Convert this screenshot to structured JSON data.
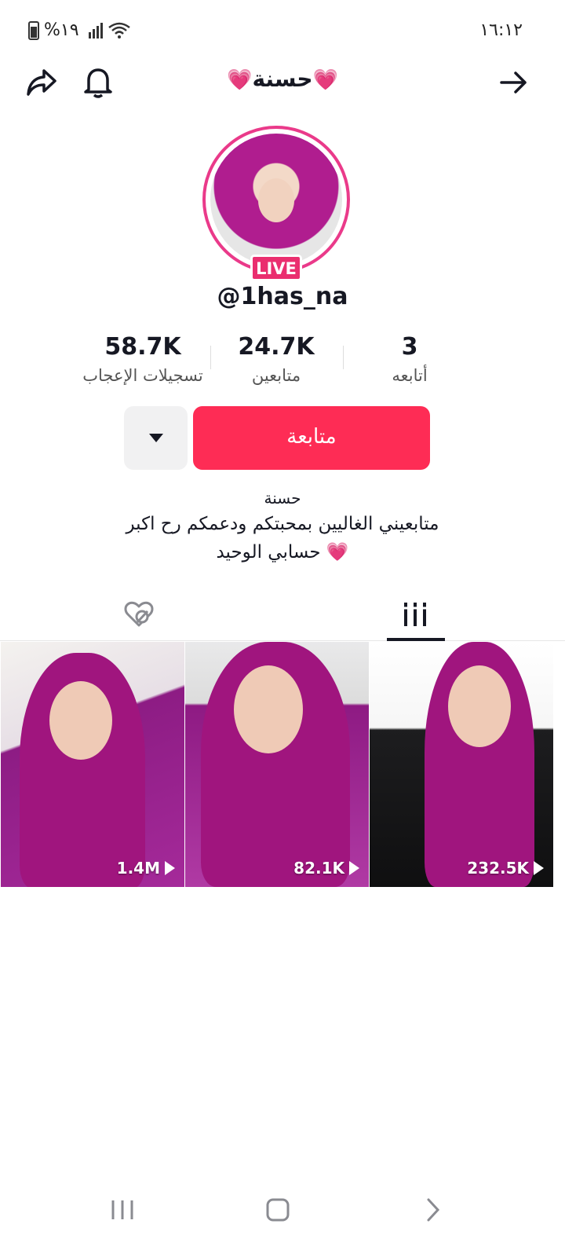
{
  "status_bar": {
    "battery_text": "%١٩",
    "time": "١٦:١٢"
  },
  "header": {
    "title": "حسنة",
    "title_heart_left": "💗",
    "title_heart_right": "💗"
  },
  "profile": {
    "live_label": "LIVE",
    "username": "@1has_na",
    "stats": {
      "likes_value": "58.7K",
      "likes_label": "تسجيلات الإعجاب",
      "followers_value": "24.7K",
      "followers_label": "متابعين",
      "following_value": "3",
      "following_label": "أتابعه"
    },
    "follow_label": "متابعة",
    "bio_name": "حسنة",
    "bio_line_1": "متابعيني الغاليين بمحبتكم ودعمكم رح اكبر",
    "bio_line_2": "حسابي الوحيد 💗"
  },
  "videos": [
    {
      "views": "1.4M"
    },
    {
      "views": "82.1K"
    },
    {
      "views": "232.5K"
    }
  ],
  "colors": {
    "accent": "#fe2c55",
    "live": "#ea2e6f",
    "text": "#161823"
  },
  "icons": {
    "share": "share-icon",
    "bell": "bell-icon",
    "back_arrow": "arrow-right-icon",
    "tab_videos": "grid-icon",
    "tab_liked": "hidden-like-icon"
  }
}
